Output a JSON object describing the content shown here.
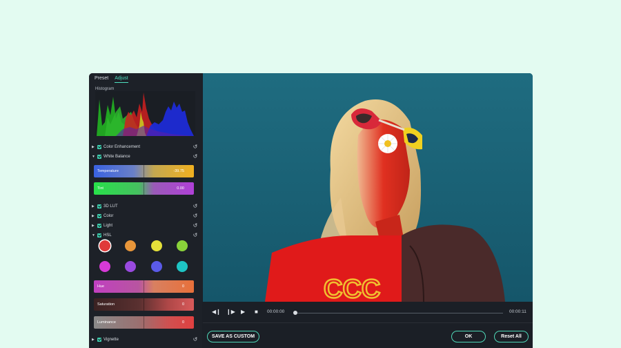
{
  "tabs": [
    {
      "label": "Preset"
    },
    {
      "label": "Adjust"
    }
  ],
  "histogram": {
    "label": "Histogram"
  },
  "sections": {
    "color_enhancement": "Color Enhancement",
    "white_balance": "White Balance",
    "lut": "3D LUT",
    "color": "Color",
    "light": "Light",
    "hsl": "HSL",
    "vignette": "Vignette"
  },
  "sliders": {
    "temperature": {
      "label": "Temperature",
      "value": "-39.75"
    },
    "tint": {
      "label": "Tint",
      "value": "0.00"
    },
    "hue": {
      "label": "Hue",
      "value": "0"
    },
    "saturation": {
      "label": "Saturation",
      "value": "0"
    },
    "luminance": {
      "label": "Luminance",
      "value": "0"
    }
  },
  "hsl_colors": [
    "#e03a3a",
    "#e8963a",
    "#e4e03a",
    "#8ad23a",
    "#d63ad6",
    "#9a4ae0",
    "#5a5ae8",
    "#1ec4c4"
  ],
  "playback": {
    "current_time": "00:00:00",
    "total_time": "00:00:11",
    "progress": 0.0
  },
  "buttons": {
    "save_custom": "SAVE AS CUSTOM",
    "ok": "OK",
    "reset_all": "Reset All"
  },
  "colors": {
    "accent": "#4fd8b8",
    "panel": "#1d2128"
  }
}
